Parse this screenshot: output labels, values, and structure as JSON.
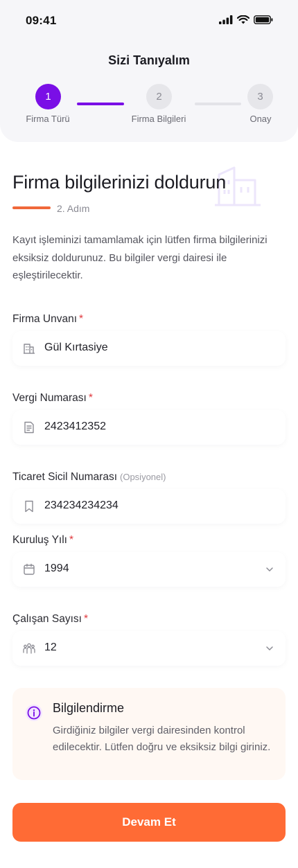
{
  "status_bar": {
    "time": "09:41"
  },
  "header": {
    "title": "Sizi Tanıyalım"
  },
  "stepper": {
    "steps": [
      {
        "number": "1",
        "label": "Firma Türü"
      },
      {
        "number": "2",
        "label": "Firma Bilgileri"
      },
      {
        "number": "3",
        "label": "Onay"
      }
    ]
  },
  "section": {
    "title": "Firma bilgilerinizi doldurun",
    "step_text": "2. Adım",
    "description": "Kayıt işleminizi tamamlamak için lütfen firma bilgilerinizi eksiksiz doldurunuz. Bu bilgiler vergi dairesi ile eşleştirilecektir."
  },
  "form": {
    "company_name": {
      "label": "Firma Unvanı",
      "required": "*",
      "value": "Gül Kırtasiye",
      "icon": "building-icon"
    },
    "tax_number": {
      "label": "Vergi Numarası",
      "required": "*",
      "value": "2423412352",
      "icon": "document-icon"
    },
    "trade_registry": {
      "label": "Ticaret Sicil Numarası",
      "optional": "(Opsiyonel)",
      "value": "234234234234",
      "icon": "bookmark-icon"
    },
    "founding_year": {
      "label": "Kuruluş Yılı",
      "required": "*",
      "value": "1994",
      "icon": "calendar-icon"
    },
    "employee_count": {
      "label": "Çalışan Sayısı",
      "required": "*",
      "value": "12",
      "icon": "people-icon"
    }
  },
  "info": {
    "title": "Bilgilendirme",
    "text": "Girdiğiniz bilgiler vergi dairesinden kontrol edilecektir. Lütfen doğru ve eksiksiz bilgi giriniz.",
    "icon": "info-icon"
  },
  "actions": {
    "submit_label": "Devam Et"
  },
  "colors": {
    "primary_purple": "#7a0fe6",
    "accent_orange": "#ff6b35",
    "required_red": "#e0393e",
    "info_background": "#fff8f3"
  }
}
